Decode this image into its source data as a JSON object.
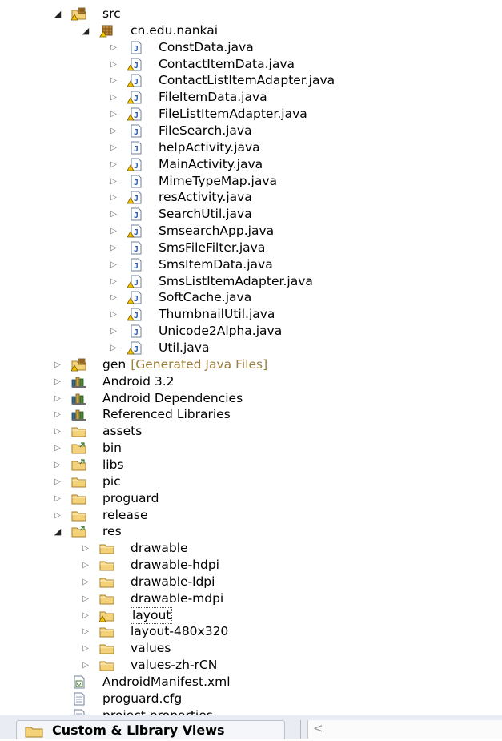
{
  "tree": {
    "items": [
      {
        "label": "src",
        "depth": 0,
        "expanded": true,
        "icon": "source-folder-icon"
      },
      {
        "label": "cn.edu.nankai",
        "depth": 1,
        "expanded": true,
        "icon": "package-icon"
      },
      {
        "label": "ConstData.java",
        "depth": 2,
        "expanded": false,
        "icon": "java-file-icon"
      },
      {
        "label": "ContactItemData.java",
        "depth": 2,
        "expanded": false,
        "icon": "java-file-warning-icon"
      },
      {
        "label": "ContactListItemAdapter.java",
        "depth": 2,
        "expanded": false,
        "icon": "java-file-warning-icon"
      },
      {
        "label": "FileItemData.java",
        "depth": 2,
        "expanded": false,
        "icon": "java-file-warning-icon"
      },
      {
        "label": "FileListItemAdapter.java",
        "depth": 2,
        "expanded": false,
        "icon": "java-file-warning-icon"
      },
      {
        "label": "FileSearch.java",
        "depth": 2,
        "expanded": false,
        "icon": "java-file-icon"
      },
      {
        "label": "helpActivity.java",
        "depth": 2,
        "expanded": false,
        "icon": "java-file-icon"
      },
      {
        "label": "MainActivity.java",
        "depth": 2,
        "expanded": false,
        "icon": "java-file-warning-icon"
      },
      {
        "label": "MimeTypeMap.java",
        "depth": 2,
        "expanded": false,
        "icon": "java-file-icon"
      },
      {
        "label": "resActivity.java",
        "depth": 2,
        "expanded": false,
        "icon": "java-file-warning-icon"
      },
      {
        "label": "SearchUtil.java",
        "depth": 2,
        "expanded": false,
        "icon": "java-file-icon"
      },
      {
        "label": "SmsearchApp.java",
        "depth": 2,
        "expanded": false,
        "icon": "java-file-warning-icon"
      },
      {
        "label": "SmsFileFilter.java",
        "depth": 2,
        "expanded": false,
        "icon": "java-file-icon"
      },
      {
        "label": "SmsItemData.java",
        "depth": 2,
        "expanded": false,
        "icon": "java-file-icon"
      },
      {
        "label": "SmsListItemAdapter.java",
        "depth": 2,
        "expanded": false,
        "icon": "java-file-warning-icon"
      },
      {
        "label": "SoftCache.java",
        "depth": 2,
        "expanded": false,
        "icon": "java-file-warning-icon"
      },
      {
        "label": "ThumbnailUtil.java",
        "depth": 2,
        "expanded": false,
        "icon": "java-file-warning-icon"
      },
      {
        "label": "Unicode2Alpha.java",
        "depth": 2,
        "expanded": false,
        "icon": "java-file-icon"
      },
      {
        "label": "Util.java",
        "depth": 2,
        "expanded": false,
        "icon": "java-file-warning-icon"
      },
      {
        "label": "gen",
        "decoration": "[Generated Java Files]",
        "depth": 0,
        "expanded": false,
        "icon": "source-folder-icon"
      },
      {
        "label": "Android 3.2",
        "depth": 0,
        "expanded": false,
        "icon": "library-icon"
      },
      {
        "label": "Android Dependencies",
        "depth": 0,
        "expanded": false,
        "icon": "library-icon"
      },
      {
        "label": "Referenced Libraries",
        "depth": 0,
        "expanded": false,
        "icon": "library-icon"
      },
      {
        "label": "assets",
        "depth": 0,
        "expanded": false,
        "icon": "folder-icon"
      },
      {
        "label": "bin",
        "depth": 0,
        "expanded": false,
        "icon": "linked-folder-icon"
      },
      {
        "label": "libs",
        "depth": 0,
        "expanded": false,
        "icon": "linked-folder-icon"
      },
      {
        "label": "pic",
        "depth": 0,
        "expanded": false,
        "icon": "folder-icon"
      },
      {
        "label": "proguard",
        "depth": 0,
        "expanded": false,
        "icon": "folder-icon"
      },
      {
        "label": "release",
        "depth": 0,
        "expanded": false,
        "icon": "folder-icon"
      },
      {
        "label": "res",
        "depth": 0,
        "expanded": true,
        "icon": "linked-folder-icon"
      },
      {
        "label": "drawable",
        "depth": 1,
        "expanded": false,
        "icon": "folder-icon"
      },
      {
        "label": "drawable-hdpi",
        "depth": 1,
        "expanded": false,
        "icon": "folder-icon"
      },
      {
        "label": "drawable-ldpi",
        "depth": 1,
        "expanded": false,
        "icon": "folder-icon"
      },
      {
        "label": "drawable-mdpi",
        "depth": 1,
        "expanded": false,
        "icon": "folder-icon"
      },
      {
        "label": "layout",
        "depth": 1,
        "expanded": false,
        "icon": "folder-warning-icon",
        "selected": true
      },
      {
        "label": "layout-480x320",
        "depth": 1,
        "expanded": false,
        "icon": "folder-icon"
      },
      {
        "label": "values",
        "depth": 1,
        "expanded": false,
        "icon": "folder-icon"
      },
      {
        "label": "values-zh-rCN",
        "depth": 1,
        "expanded": false,
        "icon": "folder-icon"
      },
      {
        "label": "AndroidManifest.xml",
        "depth": 0,
        "leaf": true,
        "icon": "xml-file-icon"
      },
      {
        "label": "proguard.cfg",
        "depth": 0,
        "leaf": true,
        "icon": "text-file-icon"
      },
      {
        "label": "project.properties",
        "depth": 0,
        "leaf": true,
        "icon": "text-file-icon"
      }
    ]
  },
  "bottom_panel": {
    "tab_label": "Custom & Library Views",
    "tab_icon": "folder-icon",
    "scroll_left_glyph": "<"
  },
  "colors": {
    "folder_fill": "#f3d27a",
    "folder_stroke": "#a8802a",
    "decoration_text": "#9a7d3d",
    "java_icon_blue": "#2a5db0"
  }
}
